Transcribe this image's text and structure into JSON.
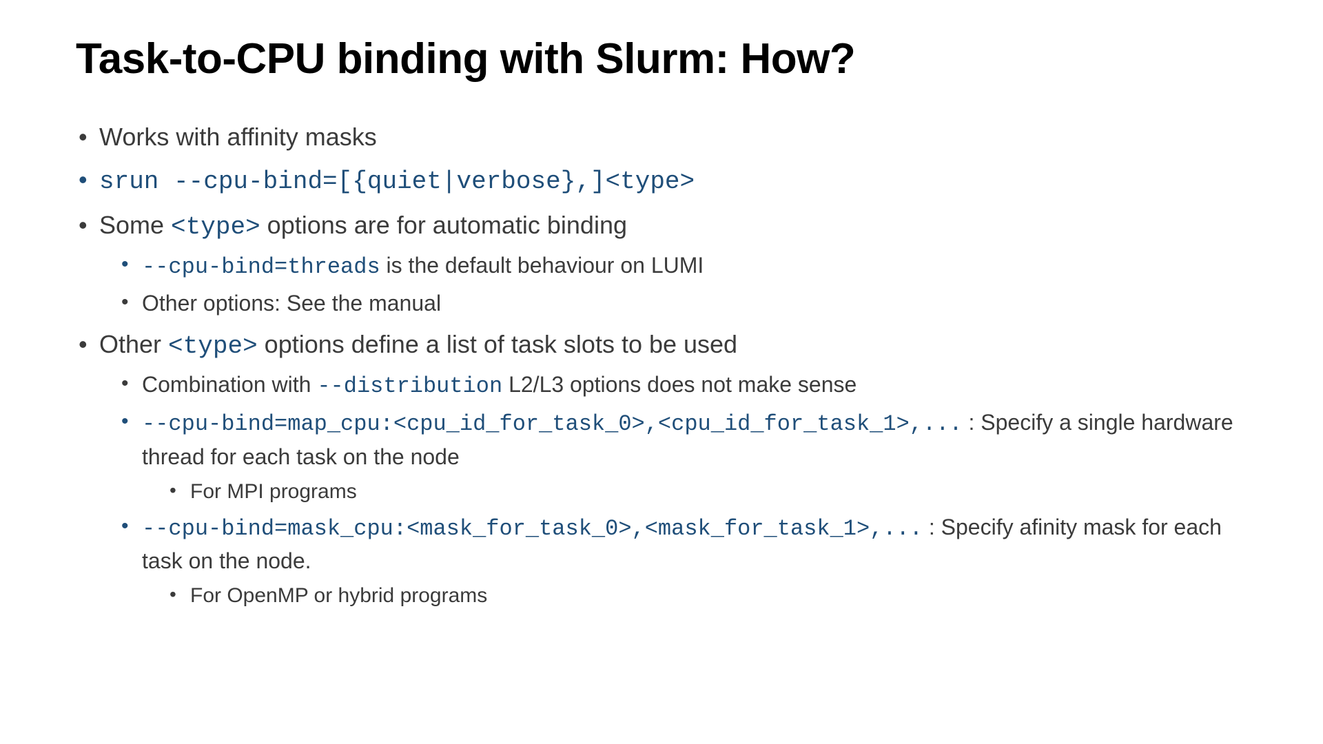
{
  "slide": {
    "title": "Task-to-CPU binding with Slurm: How?",
    "b1": "Works with affinity masks",
    "b2_code": "srun --cpu-bind=[{quiet|verbose},]<type>",
    "b3_pre": "Some ",
    "b3_code": "<type>",
    "b3_post": " options are for automatic binding",
    "b3_1_code": "--cpu-bind=threads",
    "b3_1_post": " is the default behaviour on LUMI",
    "b3_2": "Other options: See the manual",
    "b4_pre": "Other ",
    "b4_code": "<type>",
    "b4_post": " options define a list of task slots to be used",
    "b4_1_pre": "Combination with ",
    "b4_1_code": "--distribution",
    "b4_1_post": " L2/L3 options does not make sense",
    "b4_2_code": "--cpu-bind=map_cpu:<cpu_id_for_task_0>,<cpu_id_for_task_1>,...",
    "b4_2_post": " : Specify a single hardware thread for each task on the node",
    "b4_2_1": "For MPI programs",
    "b4_3_code": "--cpu-bind=mask_cpu:<mask_for_task_0>,<mask_for_task_1>,...",
    "b4_3_post": " : Specify afinity mask for each task on the node.",
    "b4_3_1": "For OpenMP or hybrid programs"
  }
}
